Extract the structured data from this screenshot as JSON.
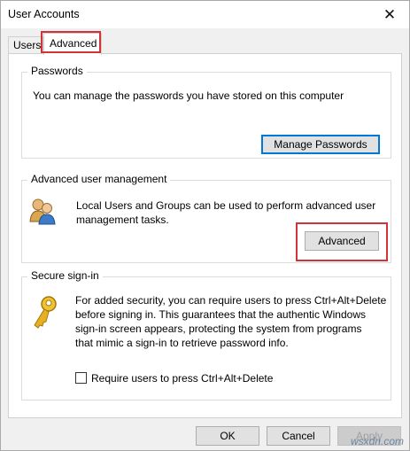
{
  "window": {
    "title": "User Accounts"
  },
  "tabs": [
    {
      "label": "Users"
    },
    {
      "label": "Advanced"
    }
  ],
  "passwords": {
    "label": "Passwords",
    "description": "You can manage the passwords you have stored on this computer",
    "button_label": "Manage Passwords"
  },
  "advanced_management": {
    "label": "Advanced user management",
    "description_line1": "Local Users and Groups can be used to perform advanced user",
    "description_line2": "management tasks.",
    "button_label": "Advanced"
  },
  "secure_signin": {
    "label": "Secure sign-in",
    "lines": [
      "For added security, you can require users to press Ctrl+Alt+Delete",
      "before signing in. This guarantees that the authentic Windows",
      "sign-in screen appears, protecting the system from programs",
      "that mimic a sign-in to retrieve password info."
    ],
    "checkbox_label": "Require users to press Ctrl+Alt+Delete",
    "checkbox_checked": false
  },
  "footer": {
    "ok_label": "OK",
    "cancel_label": "Cancel",
    "apply_label": "Apply"
  },
  "watermark": "wsxdn.com",
  "colors": {
    "highlight": "#d13438",
    "accent": "#0078d7"
  }
}
